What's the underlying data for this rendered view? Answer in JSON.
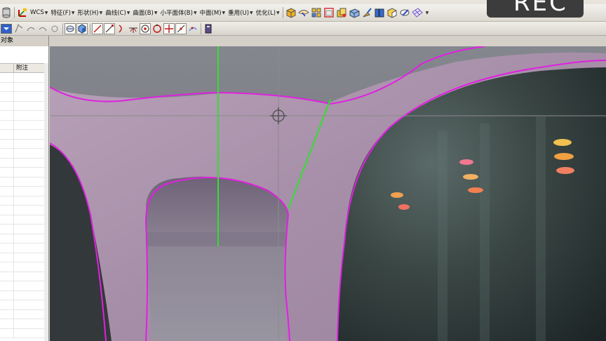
{
  "toolbar": {
    "menus": [
      {
        "label": "WCS",
        "has_dropdown": true
      },
      {
        "label": "特征(F)",
        "has_dropdown": true
      },
      {
        "label": "形状(H)",
        "has_dropdown": true
      },
      {
        "label": "曲线(C)",
        "has_dropdown": true
      },
      {
        "label": "曲面(B)",
        "has_dropdown": true
      },
      {
        "label": "小平面体(B)",
        "has_dropdown": true
      },
      {
        "label": "中面(M)",
        "has_dropdown": true
      },
      {
        "label": "重用(U)",
        "has_dropdown": true
      },
      {
        "label": "优化(L)",
        "has_dropdown": true
      }
    ]
  },
  "recording_overlay": {
    "text": "REC"
  },
  "left_panel": {
    "title": "对象",
    "columns": [
      "",
      "附注"
    ]
  },
  "colors": {
    "outline_magenta": "#e020e0",
    "guide_green": "#30e030",
    "frame_purple": "#b49ab4"
  }
}
